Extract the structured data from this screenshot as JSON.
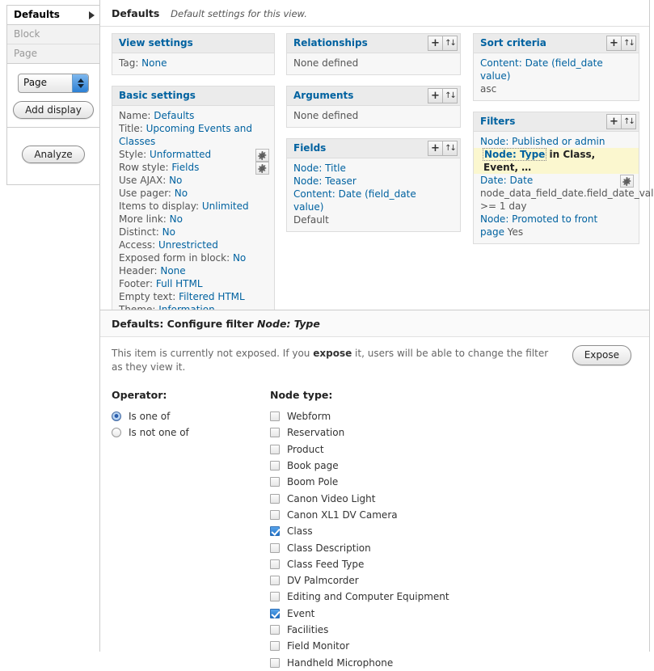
{
  "sidebar": {
    "display_tabs": [
      {
        "label": "Defaults",
        "active": true
      },
      {
        "label": "Block",
        "active": false
      },
      {
        "label": "Page",
        "active": false
      }
    ],
    "display_select_value": "Page",
    "add_display_label": "Add display",
    "analyze_label": "Analyze"
  },
  "main_header": {
    "title": "Defaults",
    "subtitle": "Default settings for this view."
  },
  "icons": {
    "add": "+",
    "rearrange": "↑↓"
  },
  "columns": {
    "col1": [
      {
        "title": "View settings",
        "has_buttons": false,
        "rows": [
          {
            "label": "Tag:",
            "value": "None",
            "link": true
          }
        ]
      },
      {
        "title": "Basic settings",
        "has_buttons": false,
        "rows": [
          {
            "label": "Name:",
            "value": "Defaults",
            "link": true
          },
          {
            "label": "Title:",
            "value": "Upcoming Events and Classes",
            "link": true
          },
          {
            "label": "Style:",
            "value": "Unformatted",
            "link": true,
            "gear": true
          },
          {
            "label": "Row style:",
            "value": "Fields",
            "link": true,
            "gear": true
          },
          {
            "label": "Use AJAX:",
            "value": "No",
            "link": true
          },
          {
            "label": "Use pager:",
            "value": "No",
            "link": true
          },
          {
            "label": "Items to display:",
            "value": "Unlimited",
            "link": true
          },
          {
            "label": "More link:",
            "value": "No",
            "link": true
          },
          {
            "label": "Distinct:",
            "value": "No",
            "link": true
          },
          {
            "label": "Access:",
            "value": "Unrestricted",
            "link": true
          },
          {
            "label": "Exposed form in block:",
            "value": "No",
            "link": true
          },
          {
            "label": "Header:",
            "value": "None",
            "link": true
          },
          {
            "label": "Footer:",
            "value": "Full HTML",
            "link": true
          },
          {
            "label": "Empty text:",
            "value": "Filtered HTML",
            "link": true
          },
          {
            "label": "Theme:",
            "value": "Information",
            "link": true
          }
        ]
      }
    ],
    "col2": [
      {
        "title": "Relationships",
        "has_buttons": true,
        "rows": [
          {
            "label": "",
            "value": "None defined",
            "link": false
          }
        ]
      },
      {
        "title": "Arguments",
        "has_buttons": true,
        "rows": [
          {
            "label": "",
            "value": "None defined",
            "link": false
          }
        ]
      },
      {
        "title": "Fields",
        "has_buttons": true,
        "rows": [
          {
            "label": "",
            "value": "Node: Title",
            "link": true
          },
          {
            "label": "",
            "value": "Node: Teaser",
            "link": true
          },
          {
            "label": "",
            "value": "Content: Date (field_date value)",
            "link": true
          },
          {
            "label": "",
            "value": "Default",
            "link": false
          }
        ]
      }
    ],
    "col3": [
      {
        "title": "Sort criteria",
        "has_buttons": true,
        "rows": [
          {
            "label": "",
            "value": "Content: Date (field_date value)",
            "link": true
          },
          {
            "label": "",
            "value": "asc",
            "link": false
          }
        ]
      },
      {
        "title": "Filters",
        "has_buttons": true,
        "rows": [
          {
            "label": "",
            "value": "Node: Published or admin",
            "link": true
          },
          {
            "label": "",
            "value": "",
            "link": false,
            "highlight": true,
            "hl_link": "Node: Type",
            "hl_rest": " in Class, Event, …"
          },
          {
            "label": "",
            "value": "Date: Date",
            "link": true,
            "gear": true
          },
          {
            "label": "",
            "value": "node_data_field_date.field_date_value",
            "link": false
          },
          {
            "label": "",
            "value": ">= 1 day",
            "link": false
          },
          {
            "label": "",
            "value": "Node: Promoted to front page",
            "link": true,
            "suffix": " Yes"
          }
        ]
      }
    ]
  },
  "config": {
    "heading_prefix": "Defaults: Configure filter ",
    "heading_italic": "Node: Type",
    "note_part1": "This item is currently not exposed. If you ",
    "note_bold": "expose",
    "note_part2": " it, users will be able to change the filter as they view it.",
    "expose_label": "Expose",
    "operator_label": "Operator:",
    "operator_options": [
      {
        "label": "Is one of",
        "selected": true
      },
      {
        "label": "Is not one of",
        "selected": false
      }
    ],
    "node_type_label": "Node type:",
    "node_types": [
      {
        "label": "Webform",
        "checked": false
      },
      {
        "label": "Reservation",
        "checked": false
      },
      {
        "label": "Product",
        "checked": false
      },
      {
        "label": "Book page",
        "checked": false
      },
      {
        "label": "Boom Pole",
        "checked": false
      },
      {
        "label": "Canon Video Light",
        "checked": false
      },
      {
        "label": "Canon XL1 DV Camera",
        "checked": false
      },
      {
        "label": "Class",
        "checked": true
      },
      {
        "label": "Class Description",
        "checked": false
      },
      {
        "label": "Class Feed Type",
        "checked": false
      },
      {
        "label": "DV Palmcorder",
        "checked": false
      },
      {
        "label": "Editing and Computer Equipment",
        "checked": false
      },
      {
        "label": "Event",
        "checked": true
      },
      {
        "label": "Facilities",
        "checked": false
      },
      {
        "label": "Field Monitor",
        "checked": false
      },
      {
        "label": "Handheld Microphone",
        "checked": false
      }
    ]
  },
  "colors": {
    "link": "#0062a0",
    "highlight_bg": "#fbf7cf",
    "panel_header_bg": "#ebebeb",
    "panel_body_bg": "#f7f7f7",
    "checkbox_checked": "#1d6fc6"
  }
}
